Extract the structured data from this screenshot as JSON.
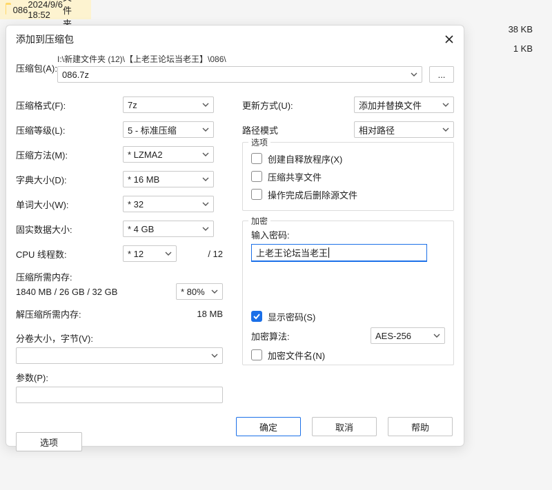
{
  "background": {
    "rows": [
      {
        "name": "086",
        "date": "2024/9/6 18:52",
        "type": "文件夹",
        "size": ""
      },
      {
        "name": "",
        "date": "",
        "type": "",
        "size": "38 KB"
      },
      {
        "name": "",
        "date": "",
        "type": "",
        "size": "1 KB"
      }
    ]
  },
  "dialog": {
    "title": "添加到压缩包",
    "archive_label": "压缩包(A):",
    "archive_path_hint": "I:\\新建文件夹 (12)\\【上老王论坛当老王】\\086\\",
    "archive_value": "086.7z",
    "browse": "...",
    "left": {
      "format_label": "压缩格式(F):",
      "format_value": "7z",
      "level_label": "压缩等级(L):",
      "level_value": "5 - 标准压缩",
      "method_label": "压缩方法(M):",
      "method_value": "* LZMA2",
      "dict_label": "字典大小(D):",
      "dict_value": "* 16 MB",
      "word_label": "单词大小(W):",
      "word_value": "* 32",
      "solid_label": "固实数据大小:",
      "solid_value": "* 4 GB",
      "threads_label": "CPU 线程数:",
      "threads_value": "* 12",
      "threads_max": "/ 12",
      "mem_compress_label": "压缩所需内存:",
      "mem_compress_value": "1840 MB / 26 GB / 32 GB",
      "mem_compress_pct": "* 80%",
      "mem_decompress_label": "解压缩所需内存:",
      "mem_decompress_value": "18 MB",
      "split_label": "分卷大小，字节(V):",
      "split_value": "",
      "params_label": "参数(P):",
      "params_value": "",
      "options_button": "选项"
    },
    "right": {
      "update_label": "更新方式(U):",
      "update_value": "添加并替换文件",
      "path_label": "路径模式",
      "path_value": "相对路径",
      "options_legend": "选项",
      "opt_sfx": "创建自释放程序(X)",
      "opt_shared": "压缩共享文件",
      "opt_delete": "操作完成后删除源文件",
      "enc_legend": "加密",
      "pw_label": "输入密码:",
      "pw_value": "上老王论坛当老王",
      "show_pw": "显示密码(S)",
      "algo_label": "加密算法:",
      "algo_value": "AES-256",
      "enc_names": "加密文件名(N)"
    },
    "footer": {
      "ok": "确定",
      "cancel": "取消",
      "help": "帮助"
    }
  }
}
